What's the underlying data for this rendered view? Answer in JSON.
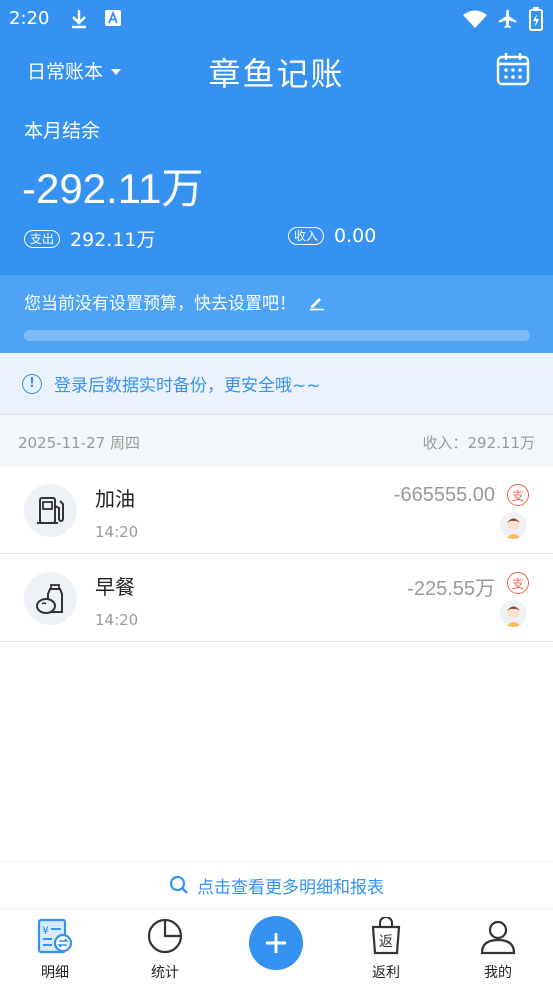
{
  "status_bar": {
    "time": "2:20",
    "icons": [
      "download-icon",
      "font-a-icon",
      "wifi-icon",
      "airplane-icon",
      "battery-icon"
    ]
  },
  "header": {
    "book_name": "日常账本",
    "app_title": "章鱼记账",
    "balance_label": "本月结余",
    "balance_value": "-292.11万",
    "expense_tag": "支出",
    "expense_value": "292.11万",
    "income_tag": "收入",
    "income_value": "0.00"
  },
  "budget": {
    "message": "您当前没有设置预算，快去设置吧！",
    "progress": 0
  },
  "notice": {
    "text": "登录后数据实时备份，更安全哦~~"
  },
  "day": {
    "date": "2025-11-27 周四",
    "summary": "收入：292.11万"
  },
  "records": [
    {
      "title": "加油",
      "time": "14:20",
      "amount": "-665555.00",
      "tag": "支",
      "icon": "fuel-pump-icon"
    },
    {
      "title": "早餐",
      "time": "14:20",
      "amount": "-225.55万",
      "tag": "支",
      "icon": "breakfast-icon"
    }
  ],
  "more_link": "点击查看更多明细和报表",
  "tabs": [
    {
      "label": "明细",
      "icon": "ledger-icon"
    },
    {
      "label": "统计",
      "icon": "pie-chart-icon"
    },
    {
      "label": "返利",
      "icon": "shopping-bag-icon",
      "badge": "返"
    },
    {
      "label": "我的",
      "icon": "user-icon"
    }
  ],
  "colors": {
    "primary": "#3592F0",
    "expense_tag": "#E9624A",
    "muted": "#999999"
  }
}
